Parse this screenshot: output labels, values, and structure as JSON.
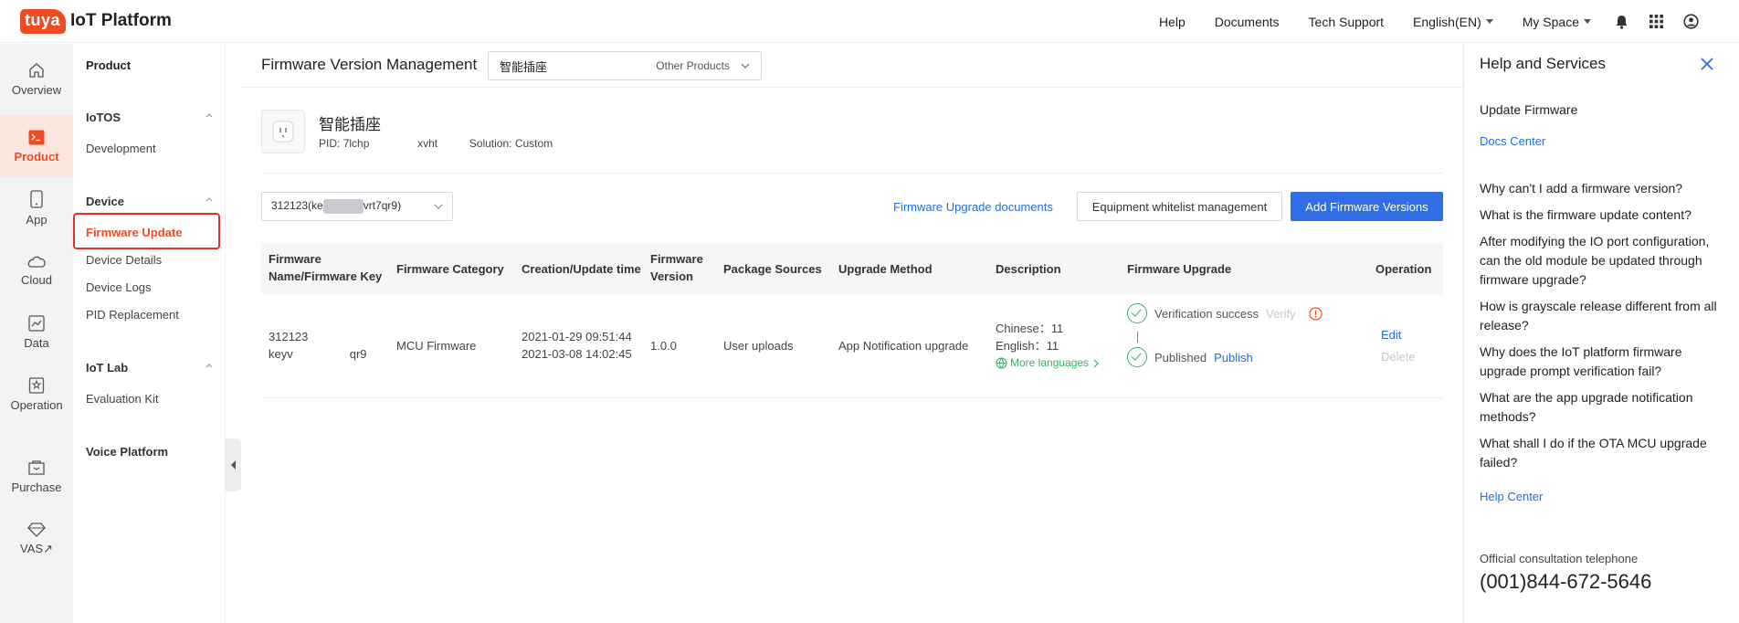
{
  "brand": {
    "logo": "tuya",
    "name": "IoT Platform"
  },
  "topnav": {
    "help": "Help",
    "documents": "Documents",
    "tech_support": "Tech Support",
    "language": "English(EN)",
    "my_space": "My Space"
  },
  "rail": [
    {
      "label": "Overview",
      "icon": "home-icon"
    },
    {
      "label": "Product",
      "icon": "product-icon",
      "active": true
    },
    {
      "label": "App",
      "icon": "phone-icon"
    },
    {
      "label": "Cloud",
      "icon": "cloud-icon"
    },
    {
      "label": "Data",
      "icon": "chart-icon"
    },
    {
      "label": "Operation",
      "icon": "operation-icon"
    },
    {
      "label": "Purchase",
      "icon": "shop-icon"
    },
    {
      "label": "VAS↗",
      "icon": "diamond-icon"
    }
  ],
  "submenu": {
    "title": "Product",
    "groups": [
      {
        "label": "IoTOS",
        "items": [
          "Development"
        ]
      },
      {
        "label": "Device",
        "items": [
          "Firmware Update",
          "Device Details",
          "Device Logs",
          "PID Replacement"
        ]
      },
      {
        "label": "IoT Lab",
        "items": [
          "Evaluation Kit"
        ]
      }
    ],
    "voice": "Voice Platform"
  },
  "page": {
    "title": "Firmware Version Management",
    "product_select": "智能插座",
    "other_products": "Other Products"
  },
  "product": {
    "name": "智能插座",
    "pid_label": "PID:",
    "pid_value": "7lchp",
    "pid_tail": "xvht",
    "solution_label": "Solution:",
    "solution_value": "Custom"
  },
  "toolbar": {
    "fw_select_prefix": "312123(ke",
    "fw_select_suffix": "vrt7qr9)",
    "docs_link": "Firmware Upgrade documents",
    "whitelist_button": "Equipment whitelist management",
    "add_button": "Add Firmware Versions"
  },
  "table": {
    "headers": {
      "name": [
        "Firmware",
        "Name/Firmware Key"
      ],
      "category": "Firmware Category",
      "time": "Creation/Update time",
      "version": [
        "Firmware",
        "Version"
      ],
      "sources": "Package Sources",
      "method": "Upgrade Method",
      "description": "Description",
      "upgrade": "Firmware Upgrade",
      "operation": "Operation"
    },
    "row": {
      "name": "312123",
      "key_prefix": "keyv",
      "key_suffix": "qr9",
      "category": "MCU Firmware",
      "created": "2021-01-29 09:51:44",
      "updated": "2021-03-08 14:02:45",
      "version": "1.0.0",
      "sources": "User uploads",
      "method": "App Notification upgrade",
      "desc_zh": "Chinese：11",
      "desc_en": "English：11",
      "more_languages": "More languages",
      "verify_status": "Verification success",
      "verify_action": "Verify",
      "publish_status": "Published",
      "publish_action": "Publish",
      "edit": "Edit",
      "delete": "Delete"
    }
  },
  "help": {
    "title": "Help and Services",
    "update_firmware": "Update Firmware",
    "docs_center": "Docs Center",
    "questions": [
      "Why can't I add a firmware version?",
      "What is the firmware update content?",
      "After modifying the IO port configuration, can the old module be updated through firmware upgrade?",
      "How is grayscale release different from all release?",
      "Why does the IoT platform firmware upgrade prompt verification fail?",
      "What are the app upgrade notification methods?",
      "What shall I do if the OTA MCU upgrade failed?"
    ],
    "help_center": "Help Center",
    "phone_label": "Official consultation telephone",
    "phone": "(001)844-672-5646"
  },
  "colors": {
    "brand": "#f04b23",
    "primary": "#2f6ee5",
    "link": "#1f6fe0",
    "success": "#35b36a",
    "highlight": "#e0322b"
  }
}
